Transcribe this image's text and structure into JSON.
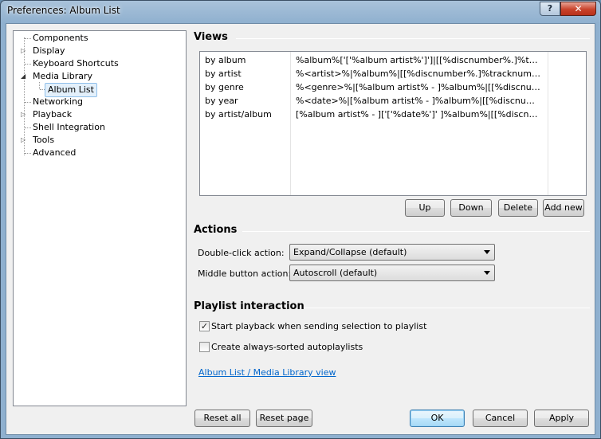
{
  "window": {
    "title": "Preferences: Album List",
    "help_glyph": "?",
    "close_glyph": "✕"
  },
  "tree": {
    "items": [
      {
        "label": "Components",
        "expandable": false,
        "selected": false
      },
      {
        "label": "Display",
        "expandable": true,
        "selected": false
      },
      {
        "label": "Keyboard Shortcuts",
        "expandable": false,
        "selected": false
      },
      {
        "label": "Media Library",
        "expandable": true,
        "expanded": true,
        "selected": false
      },
      {
        "label": "Album List",
        "expandable": false,
        "selected": true
      },
      {
        "label": "Networking",
        "expandable": false,
        "selected": false
      },
      {
        "label": "Playback",
        "expandable": true,
        "selected": false
      },
      {
        "label": "Shell Integration",
        "expandable": false,
        "selected": false
      },
      {
        "label": "Tools",
        "expandable": true,
        "selected": false
      },
      {
        "label": "Advanced",
        "expandable": false,
        "selected": false
      }
    ]
  },
  "views": {
    "heading": "Views",
    "rows": [
      {
        "name": "by album",
        "pattern": "%album%['['%album artist%']']|[[%discnumber%.]%tracknumber%. ][%track artist% - ]%title%"
      },
      {
        "name": "by artist",
        "pattern": "%<artist>%|%album%|[[%discnumber%.]%tracknumber%. ][%track artist% - ]%title%"
      },
      {
        "name": "by genre",
        "pattern": "%<genre>%|[%album artist% - ]%album%|[[%discnumber%.]%tracknumber%. ]%title%"
      },
      {
        "name": "by year",
        "pattern": "%<date>%|[%album artist% - ]%album%|[[%discnumber%.]%tracknumber%. ]%title%"
      },
      {
        "name": "by artist/album",
        "pattern": "[%album artist% - ]['['%date%']' ]%album%|[[%discnumber%.]%tracknumber%. ]%title%"
      }
    ],
    "buttons": {
      "up": "Up",
      "down": "Down",
      "delete": "Delete",
      "add_new": "Add new"
    }
  },
  "actions": {
    "heading": "Actions",
    "double_click_label": "Double-click action:",
    "double_click_value": "Expand/Collapse (default)",
    "middle_button_label": "Middle button action:",
    "middle_button_value": "Autoscroll (default)"
  },
  "playlist": {
    "heading": "Playlist interaction",
    "start_playback_label": "Start playback when sending selection to playlist",
    "start_playback_checked": true,
    "always_sorted_label": "Create always-sorted autoplaylists",
    "always_sorted_checked": false,
    "check_glyph": "✓",
    "link_text": "Album List / Media Library view"
  },
  "footer": {
    "reset_all": "Reset all",
    "reset_page": "Reset page",
    "ok": "OK",
    "cancel": "Cancel",
    "apply": "Apply"
  }
}
